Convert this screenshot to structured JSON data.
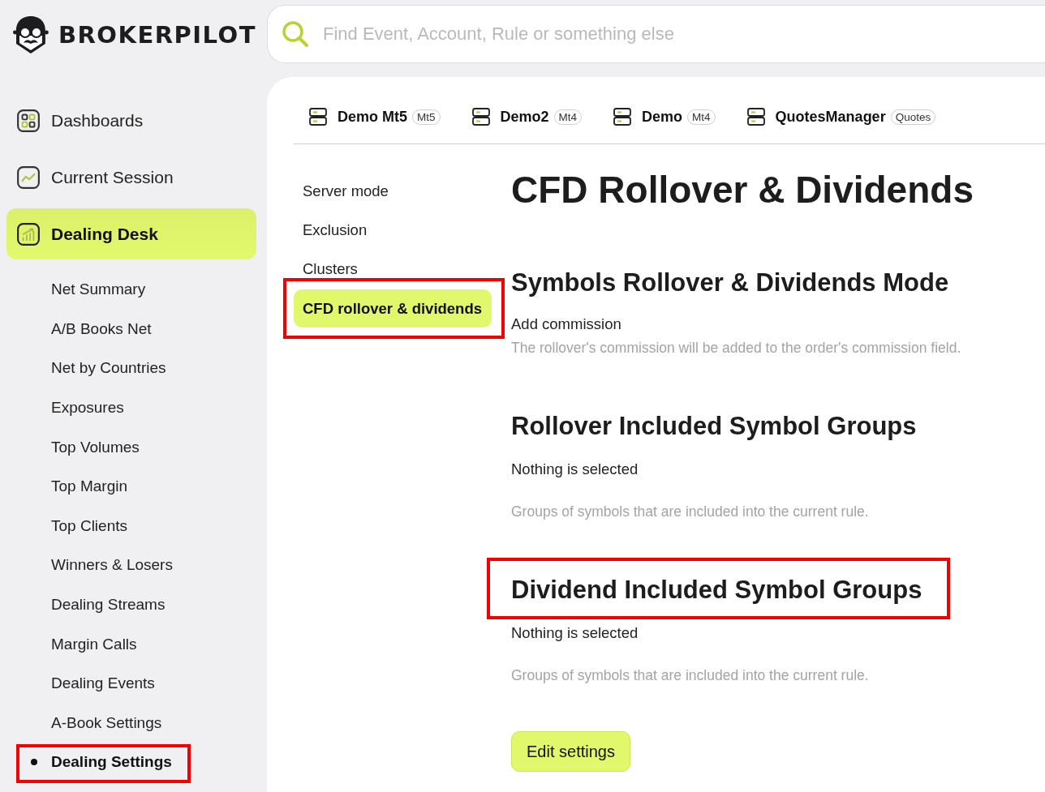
{
  "brand": {
    "name": "BROKERPILOT"
  },
  "search": {
    "placeholder": "Find Event, Account, Rule or something else"
  },
  "nav": [
    {
      "label": "Dashboards",
      "selected": false
    },
    {
      "label": "Current Session",
      "selected": false
    },
    {
      "label": "Dealing Desk",
      "selected": true
    }
  ],
  "subnav": [
    {
      "label": "Net Summary",
      "selected": false,
      "highlighted": false
    },
    {
      "label": "A/B Books Net",
      "selected": false,
      "highlighted": false
    },
    {
      "label": "Net by Countries",
      "selected": false,
      "highlighted": false
    },
    {
      "label": "Exposures",
      "selected": false,
      "highlighted": false
    },
    {
      "label": "Top Volumes",
      "selected": false,
      "highlighted": false
    },
    {
      "label": "Top Margin",
      "selected": false,
      "highlighted": false
    },
    {
      "label": "Top Clients",
      "selected": false,
      "highlighted": false
    },
    {
      "label": "Winners & Losers",
      "selected": false,
      "highlighted": false
    },
    {
      "label": "Dealing Streams",
      "selected": false,
      "highlighted": false
    },
    {
      "label": "Margin Calls",
      "selected": false,
      "highlighted": false
    },
    {
      "label": "Dealing Events",
      "selected": false,
      "highlighted": false
    },
    {
      "label": "A-Book Settings",
      "selected": false,
      "highlighted": false
    },
    {
      "label": "Dealing Settings",
      "selected": true,
      "highlighted": true
    }
  ],
  "servers": [
    {
      "name": "Demo Mt5",
      "badge": "Mt5"
    },
    {
      "name": "Demo2",
      "badge": "Mt4"
    },
    {
      "name": "Demo",
      "badge": "Mt4"
    },
    {
      "name": "QuotesManager",
      "badge": "Quotes"
    }
  ],
  "settings_menu": [
    {
      "label": "Server mode",
      "selected": false,
      "highlighted": false
    },
    {
      "label": "Exclusion",
      "selected": false,
      "highlighted": false
    },
    {
      "label": "Clusters",
      "selected": false,
      "highlighted": false
    },
    {
      "label": "CFD rollover & dividends",
      "selected": true,
      "highlighted": true
    }
  ],
  "page_title": "CFD Rollover & Dividends",
  "sections": [
    {
      "kind": "option",
      "heading": "Symbols Rollover & Dividends Mode",
      "highlighted": false,
      "label": "Add commission",
      "description": "The rollover's commission will be added to the order's commission field."
    },
    {
      "kind": "groups",
      "heading": "Rollover Included Symbol Groups",
      "highlighted": false,
      "label": "Nothing is selected",
      "description": "Groups of symbols that are included into the current rule."
    },
    {
      "kind": "groups",
      "heading": "Dividend Included Symbol Groups",
      "highlighted": true,
      "label": "Nothing is selected",
      "description": "Groups of symbols that are included into the current rule."
    }
  ],
  "buttons": [
    {
      "label": "Edit settings"
    }
  ]
}
